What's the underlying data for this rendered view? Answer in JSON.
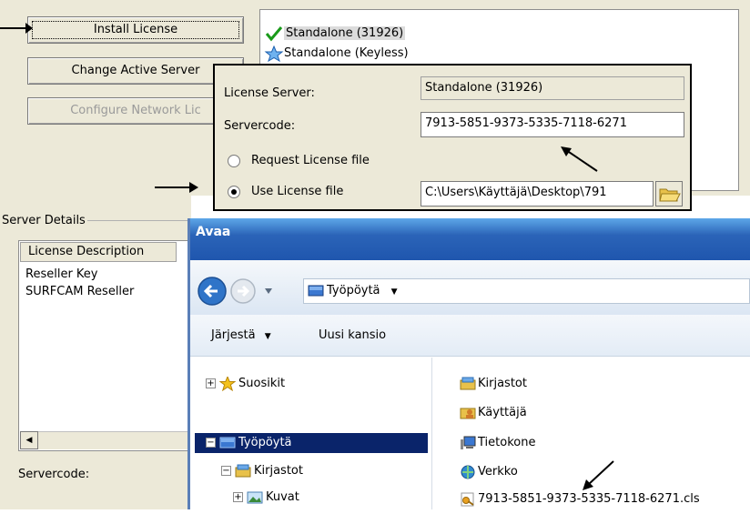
{
  "license_panel": {
    "install_button": "Install License",
    "change_server_button": "Change Active Server",
    "configure_button": "Configure Network Lic"
  },
  "server_list": {
    "items": [
      {
        "label": "Standalone (31926)",
        "icon": "checkmark-icon"
      },
      {
        "label": "Standalone (Keyless)",
        "icon": "star-icon"
      }
    ]
  },
  "popup": {
    "license_server_label": "License Server:",
    "license_server_value": "Standalone (31926)",
    "servercode_label": "Servercode:",
    "servercode_value": "7913-5851-9373-5335-7118-6271",
    "request_file_label": "Request License file",
    "use_file_label": "Use License file",
    "license_path": "C:\\Users\\Käyttäjä\\Desktop\\791"
  },
  "server_details": {
    "group_label": "Server Details",
    "column_header": "License Description",
    "rows": [
      "Reseller Key",
      "SURFCAM Reseller"
    ],
    "servercode_label": "Servercode:"
  },
  "dialog": {
    "title": "Avaa",
    "breadcrumb": "Työpöytä",
    "organize_label": "Järjestä",
    "new_folder_label": "Uusi kansio",
    "nav_items": [
      {
        "label": "Suosikit",
        "icon": "star-icon"
      },
      {
        "label": "Työpöytä",
        "icon": "desktop-icon"
      },
      {
        "label": "Kirjastot",
        "icon": "library-icon"
      },
      {
        "label": "Kuvat",
        "icon": "pictures-icon"
      }
    ],
    "files": [
      {
        "label": "Kirjastot",
        "icon": "library-icon"
      },
      {
        "label": "Käyttäjä",
        "icon": "user-folder-icon"
      },
      {
        "label": "Tietokone",
        "icon": "computer-icon"
      },
      {
        "label": "Verkko",
        "icon": "network-icon"
      },
      {
        "label": "7913-5851-9373-5335-7118-6271.cls",
        "icon": "license-file-icon"
      }
    ]
  },
  "colors": {
    "window_bg": "#ece9d8",
    "title_bar": "#1f56ae",
    "selection": "#0a246a"
  }
}
